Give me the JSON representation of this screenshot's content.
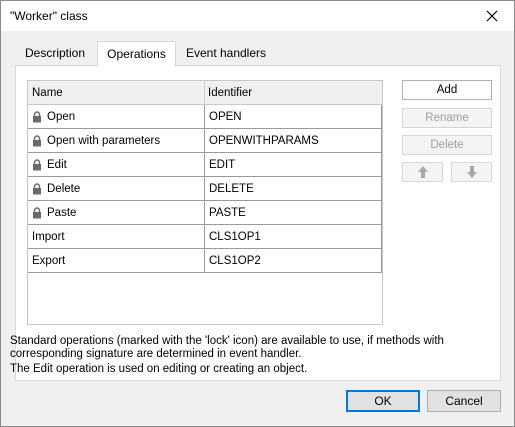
{
  "window": {
    "title": "\"Worker\" class"
  },
  "tabs": [
    {
      "label": "Description"
    },
    {
      "label": "Operations"
    },
    {
      "label": "Event handlers"
    }
  ],
  "grid": {
    "columns": [
      "Name",
      "Identifier"
    ],
    "rows": [
      {
        "name": "Open",
        "identifier": "OPEN",
        "locked": true
      },
      {
        "name": "Open with parameters",
        "identifier": "OPENWITHPARAMS",
        "locked": true
      },
      {
        "name": "Edit",
        "identifier": "EDIT",
        "locked": true
      },
      {
        "name": "Delete",
        "identifier": "DELETE",
        "locked": true
      },
      {
        "name": "Paste",
        "identifier": "PASTE",
        "locked": true
      },
      {
        "name": "Import",
        "identifier": "CLS1OP1",
        "locked": false
      },
      {
        "name": "Export",
        "identifier": "CLS1OP2",
        "locked": false
      }
    ]
  },
  "side_buttons": {
    "add": "Add",
    "rename": "Rename",
    "delete": "Delete"
  },
  "notes": {
    "line1": "Standard operations (marked with the 'lock' icon) are available to use, if methods with",
    "line2": "corresponding signature are determined in event handler.",
    "line3": "The Edit operation is used on editing or creating an object."
  },
  "footer": {
    "ok": "OK",
    "cancel": "Cancel"
  },
  "colors": {
    "accent": "#0078d7",
    "panel": "#ffffff",
    "chrome": "#f0f0f0"
  }
}
